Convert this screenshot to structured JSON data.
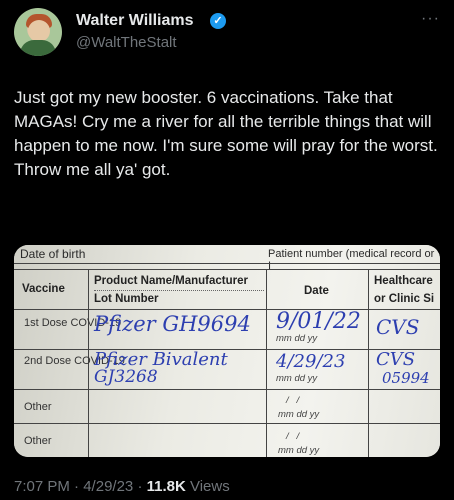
{
  "author": {
    "name": "Walter Williams",
    "handle": "@WaltTheStalt"
  },
  "tweet": {
    "text": "Just got my new booster. 6 vaccinations. Take that MAGAs! Cry me a river for all the terrible things that will happen to me now. I'm sure some will pray for the worst. Throw me all ya' got."
  },
  "card": {
    "dob_label": "Date of birth",
    "patient_label": "Patient number (medical record or I",
    "col_vaccine": "Vaccine",
    "col_product": "Product Name/Manufacturer",
    "col_lot": "Lot Number",
    "col_date": "Date",
    "col_health_1": "Healthcare",
    "col_health_2": "or Clinic Si",
    "rows": [
      {
        "label": "1st Dose COVID-19",
        "product": "Pfizer GH9694",
        "date": "9/01/22",
        "site": "CVS"
      },
      {
        "label": "2nd Dose COVID-19",
        "product": "Pfizer Bivalent",
        "lot": "GJ3268",
        "date": "4/29/23",
        "site": "CVS",
        "site_num": "05994"
      },
      {
        "label": "Other"
      },
      {
        "label": "Other"
      }
    ],
    "date_guide": "mm  dd  yy"
  },
  "meta": {
    "time": "7:07 PM",
    "sep1": "·",
    "date": "4/29/23",
    "sep2": "·",
    "views": "11.8K",
    "views_label": "Views"
  },
  "icons": {
    "verified": "verified-badge-icon",
    "more": "more-icon"
  },
  "colors": {
    "background": "#000000",
    "text": "#e7e9ea",
    "muted": "#71767b",
    "verified": "#1d9bf0",
    "ink": "#2d3fb0"
  }
}
